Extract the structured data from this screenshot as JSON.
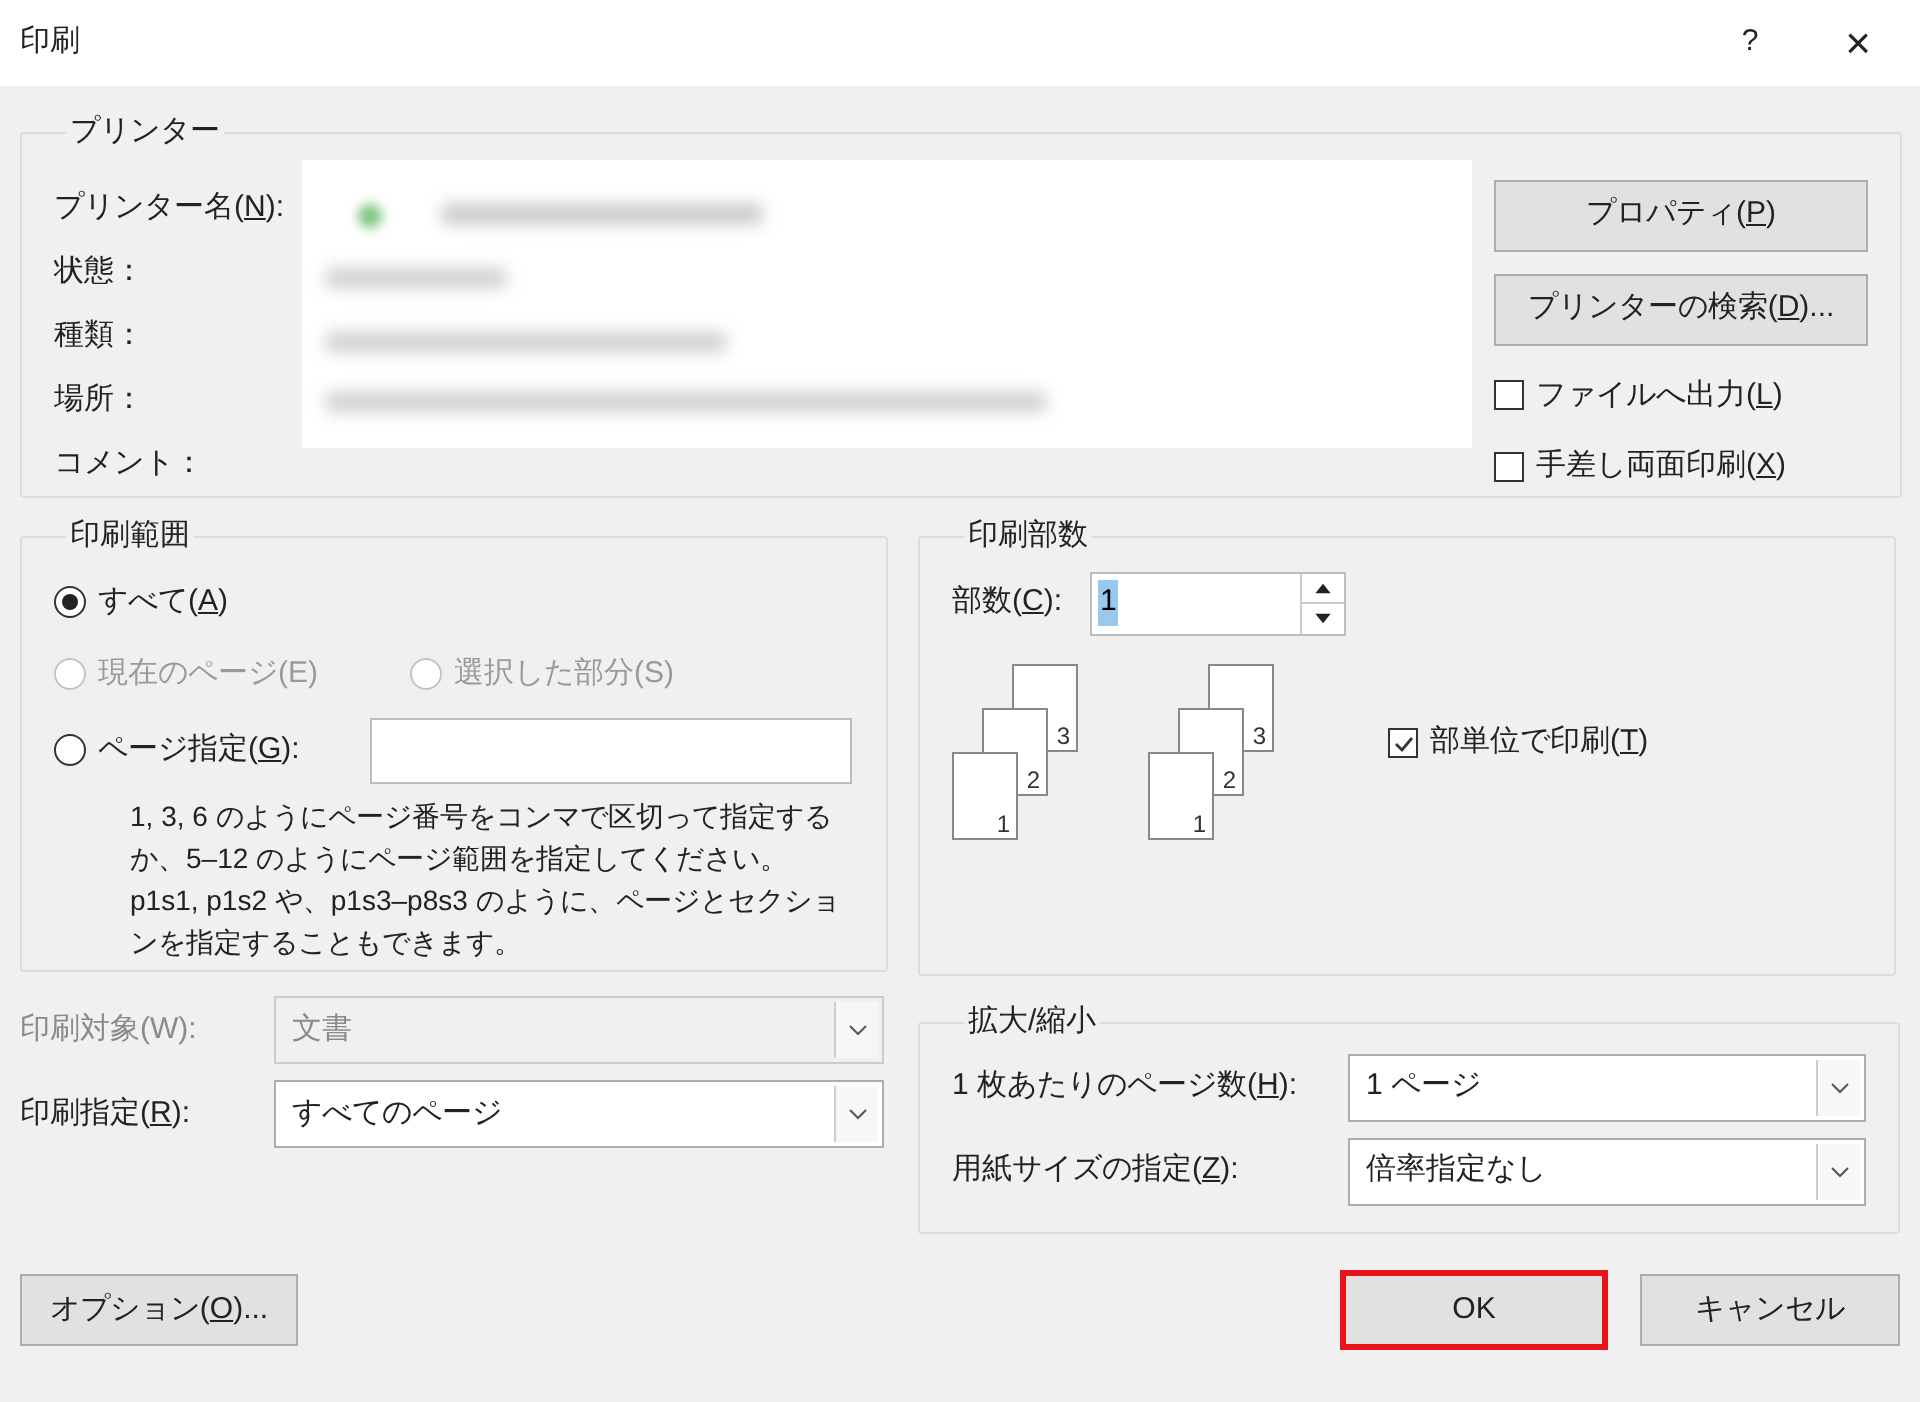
{
  "window": {
    "title": "印刷",
    "help": "?",
    "close": "×"
  },
  "printer": {
    "title": "プリンター",
    "fields": [
      {
        "label": {
          "pre": "プリンター名(",
          "key": "N",
          "post": "):"
        }
      },
      {
        "label": "状態："
      },
      {
        "label": "種類："
      },
      {
        "label": "場所："
      },
      {
        "label": "コメント："
      }
    ],
    "buttons": [
      {
        "label": {
          "pre": "プロパティ(",
          "key": "P",
          "post": ")"
        }
      },
      {
        "label": {
          "pre": "プリンターの検索(",
          "key": "D",
          "post": ")..."
        }
      }
    ],
    "options": [
      {
        "label": {
          "pre": "ファイルへ出力(",
          "key": "L",
          "post": ")"
        },
        "checked": false
      },
      {
        "label": {
          "pre": "手差し両面印刷(",
          "key": "X",
          "post": ")"
        },
        "checked": false
      }
    ]
  },
  "print_range": {
    "title": "印刷範囲",
    "options": [
      {
        "label": {
          "pre": "すべて(",
          "key": "A",
          "post": ")"
        },
        "selected": true,
        "disabled": false
      },
      {
        "label": "現在のページ(E)",
        "selected": false,
        "disabled": true
      },
      {
        "label": "選択した部分(S)",
        "selected": false,
        "disabled": true
      },
      {
        "label": {
          "pre": "ページ指定(",
          "key": "G",
          "post": "):"
        },
        "selected": false,
        "disabled": false
      }
    ],
    "hint": "1, 3, 6 のようにページ番号をコンマで区切って指定するか、5–12 のようにページ範囲を指定してください。p1s1, p1s2 や、p1s3–p8s3 のように、ページとセクションを指定することもできます。"
  },
  "copies": {
    "title": "印刷部数",
    "label": {
      "pre": "部数(",
      "key": "C",
      "post": "):"
    },
    "value": "1",
    "stacks": [
      [
        "3",
        "2",
        "1"
      ],
      [
        "3",
        "2",
        "1"
      ]
    ],
    "collate": {
      "label": {
        "pre": "部単位で印刷(",
        "key": "T",
        "post": ")"
      },
      "checked": true
    }
  },
  "print_what": [
    {
      "label": "印刷対象(W):",
      "value": "文書",
      "disabled": true
    },
    {
      "label": {
        "pre": "印刷指定(",
        "key": "R",
        "post": "):"
      },
      "value": "すべてのページ",
      "disabled": false
    }
  ],
  "zoom": {
    "title": "拡大/縮小",
    "rows": [
      {
        "label": {
          "pre": "1 枚あたりのページ数(",
          "key": "H",
          "post": "):"
        },
        "value": "1 ページ"
      },
      {
        "label": {
          "pre": "用紙サイズの指定(",
          "key": "Z",
          "post": "):"
        },
        "value": "倍率指定なし"
      }
    ]
  },
  "footer": {
    "options": {
      "pre": "オプション(",
      "key": "O",
      "post": ")..."
    },
    "ok": {
      "label": "OK",
      "highlighted": true
    },
    "cancel": "キャンセル"
  }
}
